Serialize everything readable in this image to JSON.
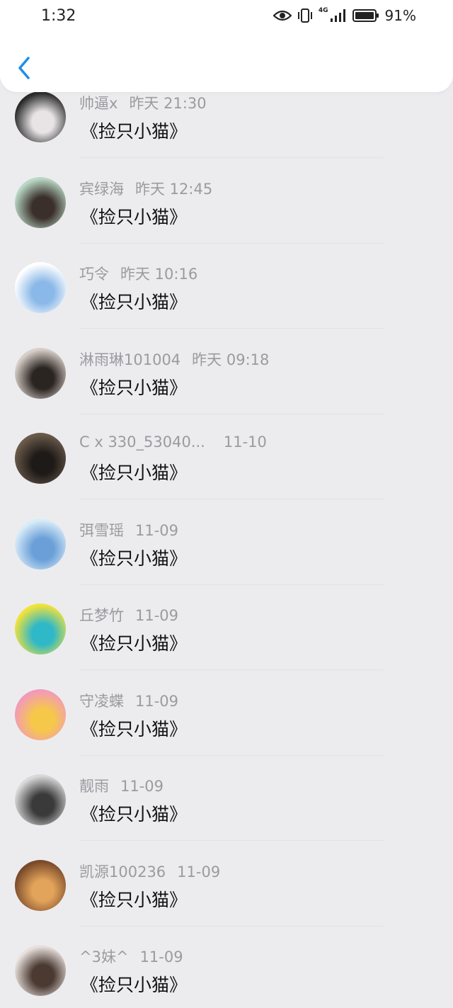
{
  "status_bar": {
    "time": "1:32",
    "battery": "91%",
    "network": "4G"
  },
  "header": {
    "back_icon": "chevron-left-icon"
  },
  "colors": {
    "accent": "#1f8fe8",
    "background": "#ececef",
    "meta_text": "#9a9aa0"
  },
  "messages": [
    {
      "name": "帅逼x",
      "time": "昨天 21:30",
      "text": "《捡只小猫》",
      "avatar_colors": [
        "#2a2a2a",
        "#e8e4e6"
      ]
    },
    {
      "name": "宾绿海",
      "time": "昨天 12:45",
      "text": "《捡只小猫》",
      "avatar_colors": [
        "#b9d7c5",
        "#3a2f2a"
      ]
    },
    {
      "name": "巧令",
      "time": "昨天 10:16",
      "text": "《捡只小猫》",
      "avatar_colors": [
        "#ffffff",
        "#8ab8e8"
      ]
    },
    {
      "name": "淋雨琳101004",
      "time": "昨天 09:18",
      "text": "《捡只小猫》",
      "avatar_colors": [
        "#d8cfc8",
        "#2b2522"
      ]
    },
    {
      "name": "C x 330_53040...",
      "time": "11-10",
      "text": "《捡只小猫》",
      "avatar_colors": [
        "#6a5a4a",
        "#1e1a18"
      ]
    },
    {
      "name": "弭雪瑶",
      "time": "11-09",
      "text": "《捡只小猫》",
      "avatar_colors": [
        "#d9ecf8",
        "#6a9fd8"
      ]
    },
    {
      "name": "丘梦竹",
      "time": "11-09",
      "text": "《捡只小猫》",
      "avatar_colors": [
        "#f2e23a",
        "#2fb8c8"
      ]
    },
    {
      "name": "守凌蝶",
      "time": "11-09",
      "text": "《捡只小猫》",
      "avatar_colors": [
        "#f29ab8",
        "#f6c84a"
      ]
    },
    {
      "name": "靓雨",
      "time": "11-09",
      "text": "《捡只小猫》",
      "avatar_colors": [
        "#d9d9d9",
        "#3a3a3a"
      ]
    },
    {
      "name": "凯源100236",
      "time": "11-09",
      "text": "《捡只小猫》",
      "avatar_colors": [
        "#7a4a2a",
        "#e2a35a"
      ]
    },
    {
      "name": "^3妹^",
      "time": "11-09",
      "text": "《捡只小猫》",
      "avatar_colors": [
        "#e8e0dc",
        "#4a3a32"
      ]
    }
  ]
}
